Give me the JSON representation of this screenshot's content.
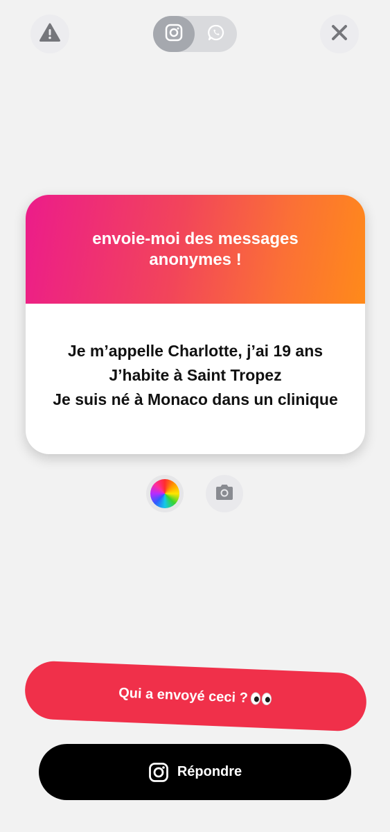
{
  "top_bar": {
    "warning_icon": "warning-triangle-icon",
    "close_icon": "close-icon",
    "share_toggle": {
      "options": [
        "instagram-icon",
        "whatsapp-icon"
      ],
      "selected": "instagram"
    }
  },
  "card": {
    "title": "envoie-moi des messages anonymes !",
    "message": "Je m’appelle Charlotte, j’ai 19 ans\nJ’habite à Saint Tropez\nJe suis né à Monaco dans un clinique",
    "header_gradient": [
      "#ec1c8a",
      "#ff8a1a"
    ]
  },
  "tools": {
    "color_icon": "color-wheel-icon",
    "camera_icon": "camera-icon"
  },
  "buttons": {
    "who_sent_label": "Qui a envoyé ceci ?",
    "who_sent_emoji": "eyes-emoji",
    "reply_label": "Répondre"
  },
  "colors": {
    "accent_red": "#f0304a",
    "reply_black": "#000000",
    "background": "#f2f2f2"
  }
}
